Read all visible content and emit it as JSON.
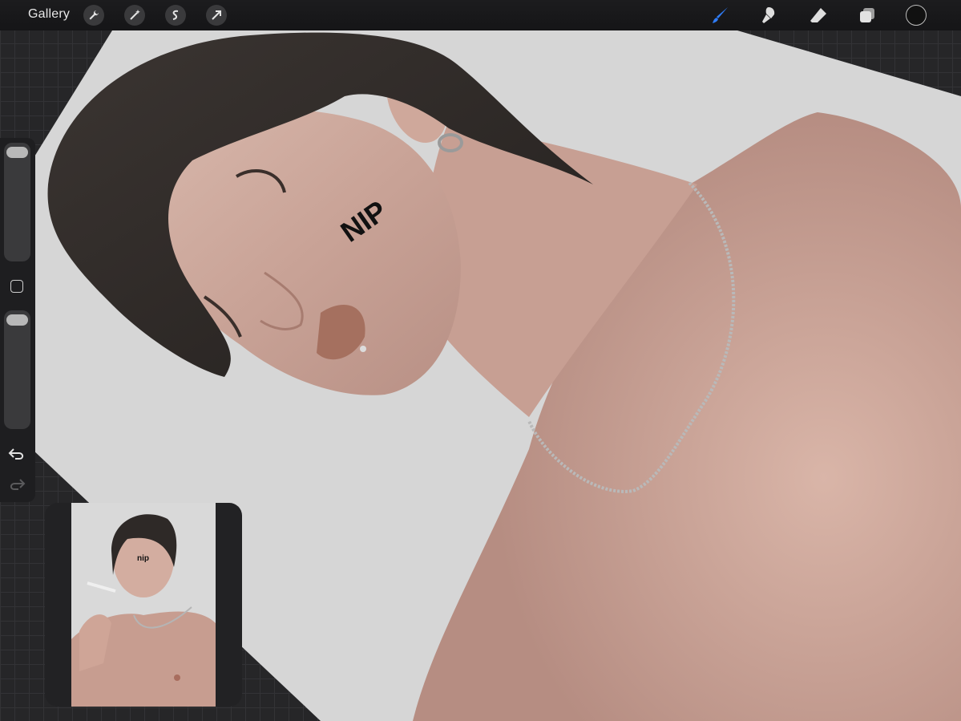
{
  "toolbar": {
    "gallery_label": "Gallery",
    "left_tools": [
      {
        "name": "actions-wrench",
        "icon": "wrench-icon"
      },
      {
        "name": "adjustments-wand",
        "icon": "magic-wand-icon"
      },
      {
        "name": "selection",
        "icon": "selection-s-icon"
      },
      {
        "name": "transform",
        "icon": "arrow-icon"
      }
    ],
    "right_tools": [
      {
        "name": "brush",
        "icon": "brush-icon",
        "active": true
      },
      {
        "name": "smudge",
        "icon": "smudge-icon"
      },
      {
        "name": "eraser",
        "icon": "eraser-icon"
      },
      {
        "name": "layers",
        "icon": "layers-icon"
      }
    ],
    "active_color": "#111111",
    "accent_color": "#2f7cf6"
  },
  "sidebar": {
    "brush_size_level": 0.95,
    "opacity_level": 0.95,
    "modifier_icon": "square-icon",
    "undo_icon": "undo-icon",
    "redo_icon": "redo-icon"
  },
  "canvas": {
    "cheek_mark_text": "NIP",
    "background_color": "#d6d6d6"
  },
  "reference": {
    "cheek_mark_text": "nip"
  }
}
